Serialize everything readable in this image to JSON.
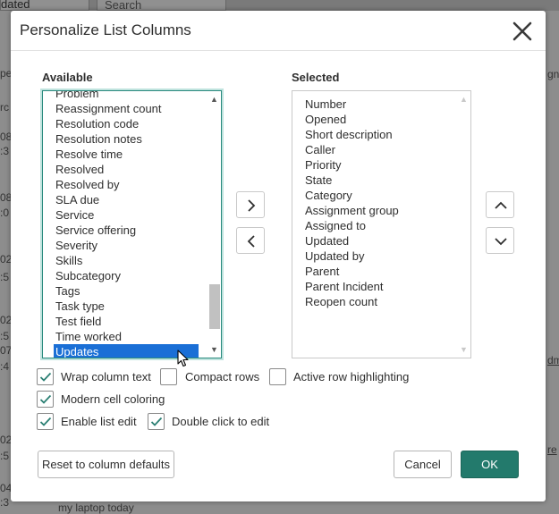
{
  "background": {
    "filter_value": "dated",
    "search_placeholder": "Search",
    "bottom_text": "my laptop today",
    "left_fragments": [
      "pe",
      "rc",
      "08",
      ":3",
      "08",
      ":0",
      "02",
      ":5",
      "02",
      ":5",
      "07",
      ":4",
      "02",
      ":5",
      "04",
      ":3",
      "02",
      ":3"
    ],
    "right_fragments": [
      "gn",
      "dm",
      "re"
    ]
  },
  "dialog": {
    "title": "Personalize List Columns",
    "available_label": "Available",
    "selected_label": "Selected",
    "available_items": [
      "Problem",
      "Reassignment count",
      "Resolution code",
      "Resolution notes",
      "Resolve time",
      "Resolved",
      "Resolved by",
      "SLA due",
      "Service",
      "Service offering",
      "Severity",
      "Skills",
      "Subcategory",
      "Tags",
      "Task type",
      "Test field",
      "Time worked",
      "Updates"
    ],
    "available_selected_index": 17,
    "available_scroll_fraction": 0.92,
    "selected_items": [
      "Number",
      "Opened",
      "Short description",
      "Caller",
      "Priority",
      "State",
      "Category",
      "Assignment group",
      "Assigned to",
      "Updated",
      "Updated by",
      "Parent",
      "Parent Incident",
      "Reopen count"
    ],
    "options": {
      "wrap_column_text": {
        "label": "Wrap column text",
        "checked": true
      },
      "compact_rows": {
        "label": "Compact rows",
        "checked": false
      },
      "active_row_highlighting": {
        "label": "Active row highlighting",
        "checked": false
      },
      "modern_cell_coloring": {
        "label": "Modern cell coloring",
        "checked": true
      },
      "enable_list_edit": {
        "label": "Enable list edit",
        "checked": true
      },
      "double_click_to_edit": {
        "label": "Double click to edit",
        "checked": true
      }
    },
    "reset_label": "Reset to column defaults",
    "cancel_label": "Cancel",
    "ok_label": "OK"
  },
  "icons": {
    "close": "close-icon",
    "add": "chevron-right-icon",
    "remove": "chevron-left-icon",
    "move_up": "chevron-up-icon",
    "move_down": "chevron-down-icon",
    "check": "checkmark-icon"
  },
  "colors": {
    "primary": "#237a6c",
    "selection": "#1a6fd6",
    "check": "#2a7f73"
  }
}
